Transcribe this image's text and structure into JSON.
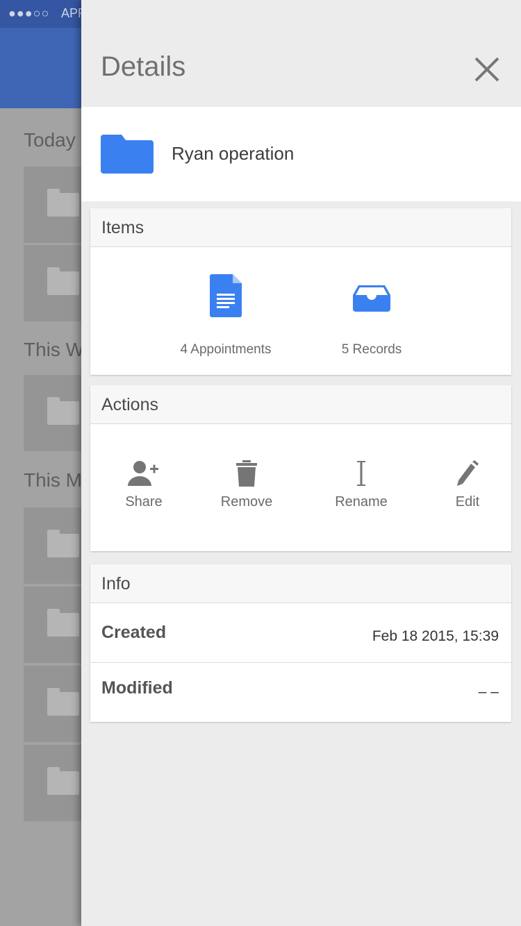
{
  "status_bar": {
    "signal": "●●●○○",
    "carrier": "APP"
  },
  "background": {
    "sections": [
      "Today",
      "This W",
      "This M"
    ]
  },
  "drawer": {
    "title": "Details",
    "folder": {
      "name": "Ryan operation",
      "icon": "folder-icon",
      "color": "#3b80f0"
    },
    "items": {
      "header": "Items",
      "entries": [
        {
          "icon": "document-icon",
          "label": "4 Appointments"
        },
        {
          "icon": "inbox-tray-icon",
          "label": "5 Records"
        }
      ]
    },
    "actions": {
      "header": "Actions",
      "buttons": [
        {
          "icon": "add-person-icon",
          "label": "Share"
        },
        {
          "icon": "trash-icon",
          "label": "Remove"
        },
        {
          "icon": "text-cursor-icon",
          "label": "Rename"
        },
        {
          "icon": "pencil-icon",
          "label": "Edit"
        }
      ]
    },
    "info": {
      "header": "Info",
      "rows": [
        {
          "key": "Created",
          "value": "Feb 18 2015, 15:39"
        },
        {
          "key": "Modified",
          "value": "– –"
        }
      ]
    }
  },
  "colors": {
    "accent_blue": "#3b80f0",
    "header_blue": "#3f66b5",
    "icon_gray": "#757575"
  }
}
